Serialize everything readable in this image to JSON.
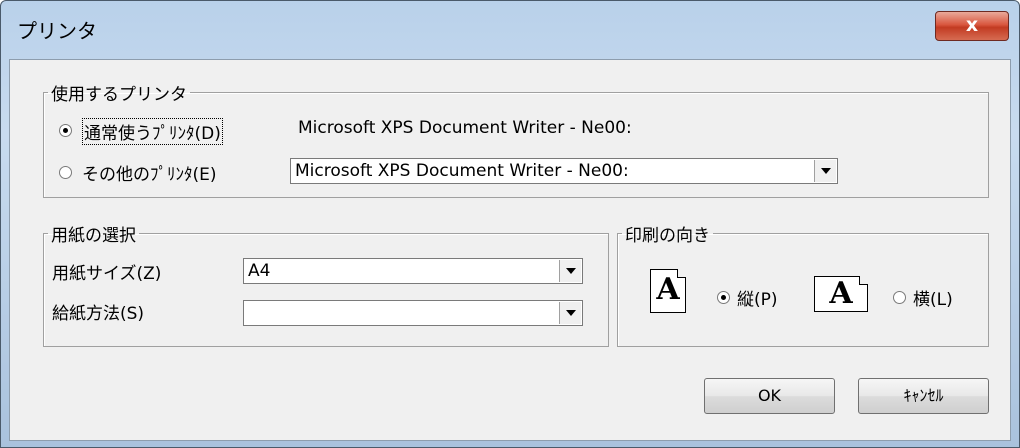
{
  "window": {
    "title": "プリンタ",
    "close_label": "x"
  },
  "printer_group": {
    "legend": "使用するプリンタ",
    "default_radio_label": "通常使うﾌﾟﾘﾝﾀ(D)",
    "default_printer_name": "Microsoft XPS Document Writer - Ne00:",
    "other_radio_label": "その他のﾌﾟﾘﾝﾀ(E)",
    "other_printer_value": "Microsoft XPS Document Writer - Ne00:",
    "selected": "default"
  },
  "paper_group": {
    "legend": "用紙の選択",
    "size_label": "用紙サイズ(Z)",
    "size_value": "A4",
    "source_label": "給紙方法(S)",
    "source_value": ""
  },
  "orientation_group": {
    "legend": "印刷の向き",
    "portrait_label": "縦(P)",
    "landscape_label": "横(L)",
    "icon_glyph": "A",
    "selected": "portrait"
  },
  "buttons": {
    "ok_label": "OK",
    "cancel_label": "ｷｬﾝｾﾙ"
  }
}
